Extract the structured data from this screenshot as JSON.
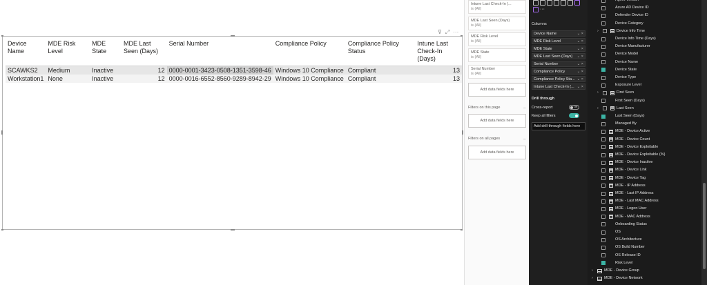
{
  "visual_toolbar": {
    "filter": "⊽",
    "focus": "⤢",
    "more": "···"
  },
  "table": {
    "headers": [
      "Device Name",
      "MDE Risk Level",
      "MDE State",
      "MDE Last Seen (Days)",
      "Serial Number",
      "Compliance Policy",
      "Compliance Policy Status",
      "Intune Last Check-In (Days)"
    ],
    "rows": [
      [
        "SCAWKS2",
        "Medium",
        "Inactive",
        "12",
        "0000-0001-3423-0508-1351-3598-46",
        "Windows 10 Compliance",
        "Compliant",
        "13"
      ],
      [
        "Workstation1",
        "None",
        "Inactive",
        "12",
        "0000-0016-6552-8560-9289-8942-29",
        "Windows 10 Compliance",
        "Compliant",
        "13"
      ]
    ]
  },
  "filters_pane": {
    "visual_filters": [
      {
        "name": "Intune Last Check-In (...",
        "value": "is (All)"
      },
      {
        "name": "MDE Last Seen (Days)",
        "value": "is (All)"
      },
      {
        "name": "MDE Risk Level",
        "value": "is (All)"
      },
      {
        "name": "MDE State",
        "value": "is (All)"
      },
      {
        "name": "Serial Number",
        "value": "is (All)"
      }
    ],
    "add_fields": "Add data fields here",
    "page_section": "Filters on this page",
    "all_section": "Filters on all pages",
    "more": "..."
  },
  "build_pane": {
    "columns_title": "Columns",
    "wells": [
      "Device Name",
      "MDE Risk Level",
      "MDE State",
      "MDE Last Seen (Days)",
      "Serial Number",
      "Compliance Policy",
      "Compliance Policy Sta...",
      "Intune Last Check-In (..."
    ],
    "well_ctrl": "⌄ ×",
    "more": "···",
    "drill_title": "Drill through",
    "cross_report": "Cross-report",
    "cross_report_state": "Off",
    "keep_filters": "Keep all filters",
    "add_drill": "Add drill-through fields here"
  },
  "fields_pane": {
    "items": [
      {
        "label": "Agent Version",
        "kind": "field",
        "checked": false
      },
      {
        "label": "Azure AD Device ID",
        "kind": "field",
        "checked": false
      },
      {
        "label": "Defender Device ID",
        "kind": "field",
        "checked": false
      },
      {
        "label": "Device Category",
        "kind": "field",
        "checked": false
      },
      {
        "label": "Device Info Time",
        "kind": "hier",
        "checked": false
      },
      {
        "label": "Device Info Time (Days)",
        "kind": "field",
        "checked": false
      },
      {
        "label": "Device Manufacturer",
        "kind": "field",
        "checked": false
      },
      {
        "label": "Device Model",
        "kind": "field",
        "checked": false
      },
      {
        "label": "Device Name",
        "kind": "field",
        "checked": false
      },
      {
        "label": "Device State",
        "kind": "field",
        "checked": true
      },
      {
        "label": "Device Type",
        "kind": "field",
        "checked": false
      },
      {
        "label": "Exposure Level",
        "kind": "field",
        "checked": false
      },
      {
        "label": "First Seen",
        "kind": "hier",
        "checked": false
      },
      {
        "label": "First Seen (Days)",
        "kind": "field",
        "checked": false
      },
      {
        "label": "Last Seen",
        "kind": "hier",
        "checked": false
      },
      {
        "label": "Last Seen (Days)",
        "kind": "field",
        "checked": true
      },
      {
        "label": "Managed By",
        "kind": "field",
        "checked": false
      },
      {
        "label": "MDE - Device Active",
        "kind": "measure",
        "checked": false
      },
      {
        "label": "MDE - Device Count",
        "kind": "measure",
        "checked": false
      },
      {
        "label": "MDE - Device Exploitable",
        "kind": "measure",
        "checked": false
      },
      {
        "label": "MDE - Device Exploitable (%)",
        "kind": "measure",
        "checked": false
      },
      {
        "label": "MDE - Device Inactive",
        "kind": "measure",
        "checked": false
      },
      {
        "label": "MDE - Device Link",
        "kind": "measure",
        "checked": false
      },
      {
        "label": "MDE - Device Tag",
        "kind": "measure",
        "checked": false
      },
      {
        "label": "MDE - IP Address",
        "kind": "measure",
        "checked": false
      },
      {
        "label": "MDE - Last IP Address",
        "kind": "measure",
        "checked": false
      },
      {
        "label": "MDE - Last MAC Address",
        "kind": "measure",
        "checked": false
      },
      {
        "label": "MDE - Logon User",
        "kind": "measure",
        "checked": false
      },
      {
        "label": "MDE - MAC Address",
        "kind": "measure",
        "checked": false
      },
      {
        "label": "Onboarding Status",
        "kind": "field",
        "checked": false
      },
      {
        "label": "OS",
        "kind": "field",
        "checked": false
      },
      {
        "label": "OS Architecture",
        "kind": "field",
        "checked": false
      },
      {
        "label": "OS Build Number",
        "kind": "field",
        "checked": false
      },
      {
        "label": "OS Release ID",
        "kind": "field",
        "checked": false
      },
      {
        "label": "Risk Level",
        "kind": "field",
        "checked": true
      }
    ],
    "tables": [
      {
        "label": "MDE - Device Group"
      },
      {
        "label": "MDE - Device Network"
      }
    ]
  },
  "colors": {
    "accent": "#3cb4a5",
    "dark_pane": "#1f1f1f",
    "row_highlight": "#e6e6e6"
  }
}
